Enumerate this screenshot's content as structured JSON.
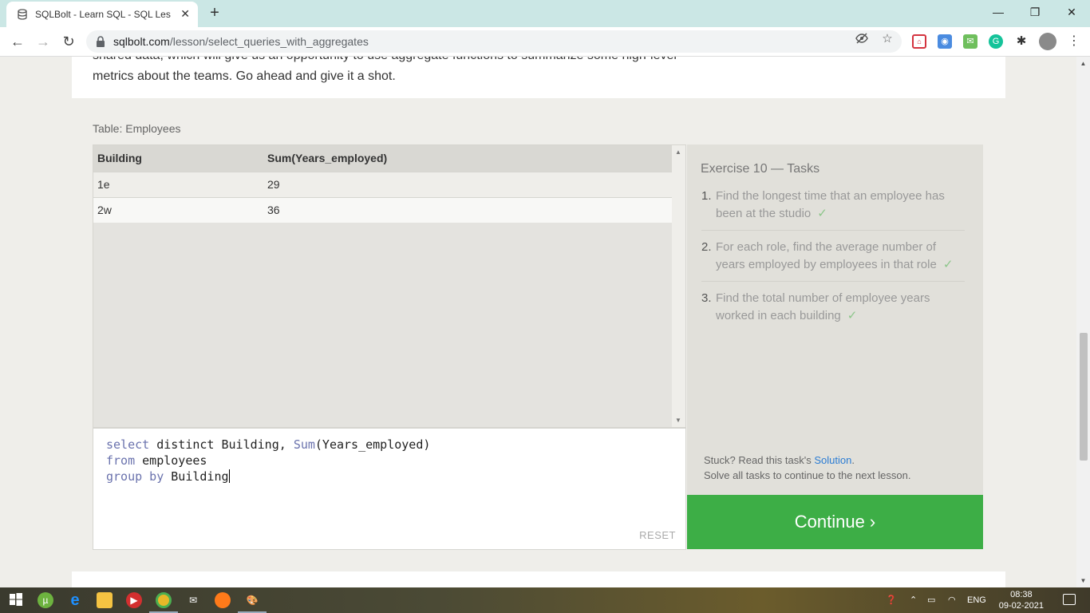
{
  "browser": {
    "tab_title": "SQLBolt - Learn SQL - SQL Lesson",
    "tab_close": "✕",
    "new_tab": "+",
    "url_host": "sqlbolt.com",
    "url_path": "/lesson/select_queries_with_aggregates",
    "window_controls": {
      "minimize": "—",
      "restore": "❐",
      "close": "✕"
    }
  },
  "page": {
    "intro_text_cut": "shared data, which will give us an opportunity to use aggregate functions to summarize some high-level",
    "intro_text": "metrics about the teams. Go ahead and give it a shot.",
    "table_label": "Table: Employees",
    "result": {
      "headers": [
        "Building",
        "Sum(Years_employed)"
      ],
      "rows": [
        [
          "1e",
          "29"
        ],
        [
          "2w",
          "36"
        ]
      ]
    },
    "editor": {
      "line1": {
        "kw1": "select",
        "t1": " distinct Building, ",
        "fn": "Sum",
        "t2": "(Years_employed)"
      },
      "line2": {
        "kw": "from",
        "t": " employees"
      },
      "line3": {
        "kw": "group by",
        "t": " Building"
      },
      "reset_label": "RESET"
    },
    "tasks": {
      "title": "Exercise 10 — Tasks",
      "items": [
        {
          "num": "1.",
          "text": "Find the longest time that an employee has been at the studio",
          "check": "✓"
        },
        {
          "num": "2.",
          "text": "For each role, find the average number of years employed by employees in that role",
          "check": "✓"
        },
        {
          "num": "3.",
          "text": "Find the total number of employee years worked in each building",
          "check": "✓"
        }
      ],
      "stuck_prefix": "Stuck? Read this task's ",
      "solution_link": "Solution",
      "stuck_suffix": ".",
      "continue_hint": "Solve all tasks to continue to the next lesson."
    },
    "continue_label": "Continue ›"
  },
  "taskbar": {
    "language": "ENG",
    "time": "08:38",
    "date": "09-02-2021"
  }
}
